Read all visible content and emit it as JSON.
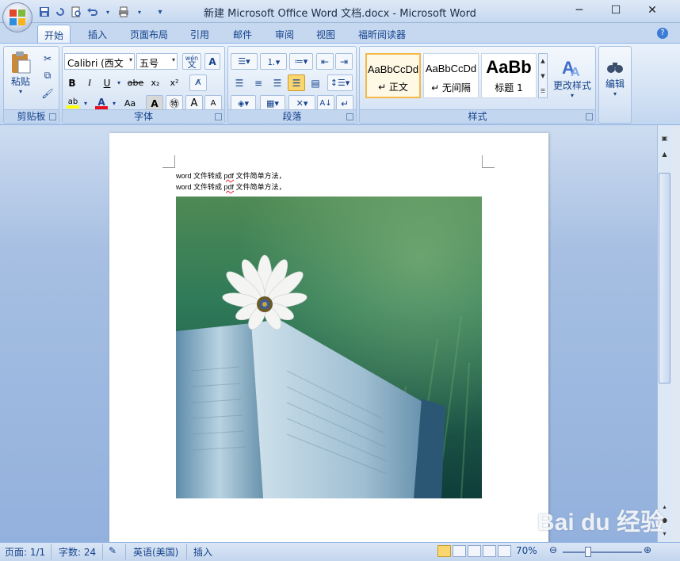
{
  "window": {
    "title": "新建 Microsoft Office Word 文档.docx - Microsoft Word",
    "minimize": "─",
    "maximize": "☐",
    "close": "✕"
  },
  "tabs": [
    "开始",
    "插入",
    "页面布局",
    "引用",
    "邮件",
    "审阅",
    "视图",
    "福昕阅读器"
  ],
  "active_tab": "开始",
  "ribbon": {
    "clipboard": {
      "label": "剪贴板",
      "paste": "粘贴"
    },
    "font": {
      "label": "字体",
      "font_name": "Calibri (西文",
      "font_size": "五号",
      "bold": "B",
      "italic": "I",
      "underline": "U",
      "strike": "abe",
      "subscript": "x₂",
      "superscript": "x²",
      "change_case": "Aa",
      "highlight": "ab",
      "font_color": "A",
      "char_border": "A",
      "grow": "A",
      "shrink": "A",
      "phonetic": "wén"
    },
    "paragraph": {
      "label": "段落"
    },
    "styles": {
      "label": "样式",
      "items": [
        {
          "sample": "AaBbCcDd",
          "name": "↵ 正文"
        },
        {
          "sample": "AaBbCcDd",
          "name": "↵ 无间隔"
        },
        {
          "sample": "AaBb",
          "name": "标题 1"
        }
      ],
      "change_styles": "更改样式"
    },
    "editing": {
      "label": "编辑"
    }
  },
  "document": {
    "lines": [
      {
        "pre": "word 文件转成 ",
        "err": "pdf",
        "post": " 文件简单方法，"
      },
      {
        "pre": "word 文件转成 ",
        "err": "pdf",
        "post": " 文件简单方法，"
      }
    ]
  },
  "status": {
    "page": "页面: 1/1",
    "words": "字数: 24",
    "language": "英语(美国)",
    "mode": "插入",
    "zoom": "70%"
  },
  "watermark": "Bai du 经验",
  "colors": {
    "ribbon": "#dfe9f7",
    "accent": "#15428b",
    "selected_style": "#f3b848"
  }
}
